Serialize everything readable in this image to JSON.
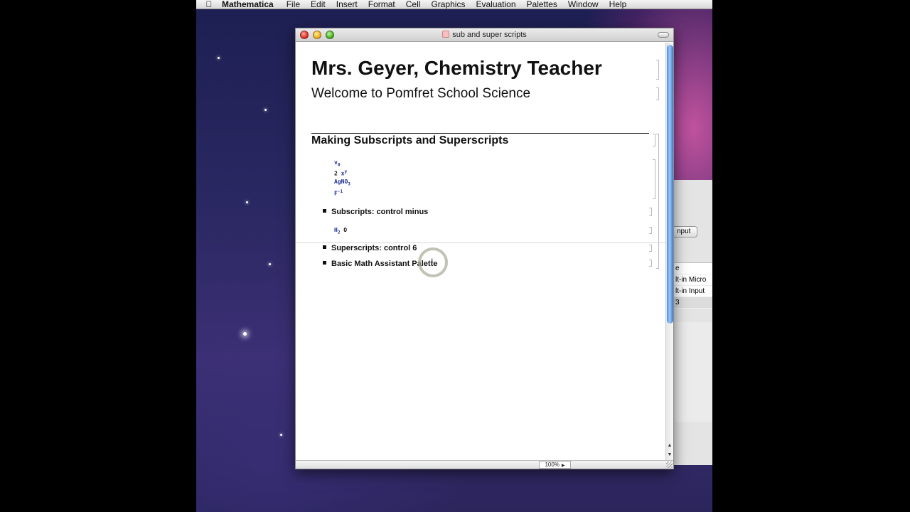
{
  "menubar": {
    "apple_icon": "apple-icon",
    "app_name": "Mathematica",
    "items": [
      "File",
      "Edit",
      "Insert",
      "Format",
      "Cell",
      "Graphics",
      "Evaluation",
      "Palettes",
      "Window",
      "Help"
    ]
  },
  "background_window": {
    "button_label": "nput",
    "list_header": "e",
    "list_items": [
      "lt-in Micro",
      "lt-in Input",
      "3"
    ]
  },
  "window": {
    "title": "sub and super scripts",
    "doc_icon": "document-icon"
  },
  "notebook": {
    "title": "Mrs. Geyer, Chemistry Teacher",
    "subtitle": "Welcome to Pomfret School Science",
    "section": "Making Subscripts and Superscripts",
    "examples": {
      "v_base": "v",
      "v_sub": "0",
      "x_coef": "2",
      "x_base": "x",
      "x_sup": "y",
      "agno_base": "AgNO",
      "agno_sub": "3",
      "f_base": "F",
      "f_sup": "-1"
    },
    "item_subscripts": "Subscripts:  control minus",
    "h2o": {
      "base": "H",
      "sub": "2",
      "rest": "O"
    },
    "item_superscripts": "Superscripts:  control 6",
    "item_palette": "Basic Math Assistant Palette"
  },
  "status": {
    "zoom": "100%"
  },
  "colors": {
    "input_blue": "#1c2f9a",
    "scroll_blue": "#4c8fe0"
  }
}
